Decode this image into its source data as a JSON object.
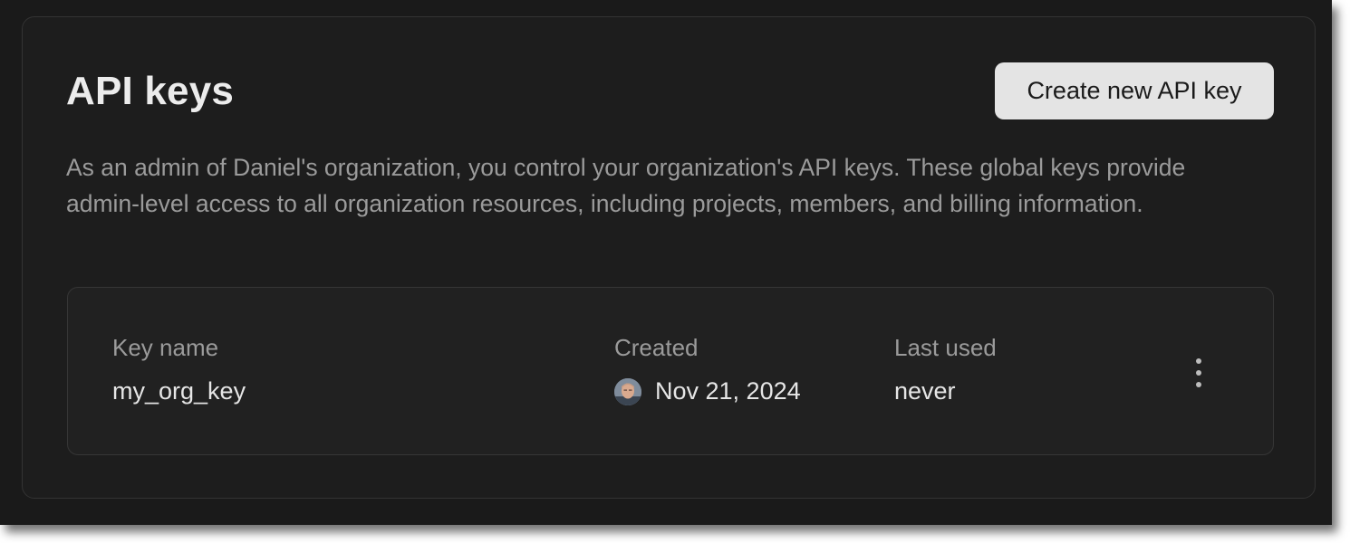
{
  "header": {
    "title": "API keys",
    "create_button_label": "Create new API key"
  },
  "description": "As an admin of Daniel's organization, you control your organization's API keys. These global keys provide admin-level access to all organization resources, including projects, members, and billing information.",
  "keys_table": {
    "columns": {
      "name": "Key name",
      "created": "Created",
      "last_used": "Last used"
    },
    "rows": [
      {
        "name": "my_org_key",
        "created": "Nov 21, 2024",
        "last_used": "never",
        "creator_avatar": "user-avatar",
        "actions_icon": "more-vertical-icon"
      }
    ]
  },
  "colors": {
    "background": "#1a1a1a",
    "panel": "#1d1d1d",
    "card": "#212121",
    "button": "#e4e4e4",
    "text_primary": "#ececec",
    "text_secondary": "#9b9b9b"
  }
}
